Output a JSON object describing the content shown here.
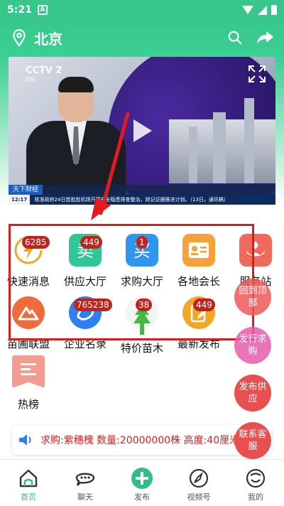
{
  "status_bar": {
    "time": "5:21",
    "notification_badge": "A"
  },
  "header": {
    "city": "北京",
    "icons": [
      "location-icon",
      "search-icon",
      "share-icon"
    ]
  },
  "video": {
    "channel_logo": "CCTV 2",
    "channel_sub": "财经",
    "program_tag": "天下财经",
    "ticker_time": "12:17",
    "ticker_text": "核准政府24日首批批机场开展安全隐患排查整治，财记证据推进计划。（13日，通讯稿）"
  },
  "grid": {
    "items": [
      {
        "label": "快速消息",
        "badge": "6285",
        "color": "#ffffff",
        "icon": "flash-icon"
      },
      {
        "label": "供应大厅",
        "badge": "449",
        "color": "#2fc79a",
        "icon": "supply-icon"
      },
      {
        "label": "求购大厅",
        "badge": "1",
        "color": "#2f95ee",
        "icon": "buy-icon"
      },
      {
        "label": "各地会长",
        "badge": "",
        "color": "#f7a13a",
        "icon": "member-card-icon"
      },
      {
        "label": "服务站",
        "badge": "",
        "color": "#ef6a5a",
        "icon": "service-station-icon"
      },
      {
        "label": "苗圃联盟",
        "badge": "",
        "color": "#f06b3a",
        "icon": "mountain-icon"
      },
      {
        "label": "企业名录",
        "badge": "765238",
        "color": "#2f7ff2",
        "icon": "directory-icon"
      },
      {
        "label": "特价苗木",
        "badge": "38",
        "color": "#45b843",
        "icon": "tree-icon"
      },
      {
        "label": "最新发布",
        "badge": "449",
        "color": "#f5a623",
        "icon": "edit-icon"
      }
    ]
  },
  "hot": {
    "label": "热榜"
  },
  "marquee": {
    "text": "求购:紫穗槐 数量:20000000株 高度:40厘米"
  },
  "fabs": {
    "back_top": "回到顶部",
    "buy": "发行求购",
    "supply": "发布供应",
    "contact": "联系客服"
  },
  "tabs": [
    {
      "label": "首页",
      "icon": "home-icon",
      "active": true
    },
    {
      "label": "聊天",
      "icon": "chat-icon",
      "active": false
    },
    {
      "label": "发布",
      "icon": "add-icon",
      "active": false
    },
    {
      "label": "视频号",
      "icon": "compass-icon",
      "active": false
    },
    {
      "label": "我的",
      "icon": "profile-icon",
      "active": false
    }
  ],
  "colors": {
    "brand_green": "#37c78a",
    "badge_red": "#c0231c",
    "highlight_red": "#d81e1e"
  }
}
